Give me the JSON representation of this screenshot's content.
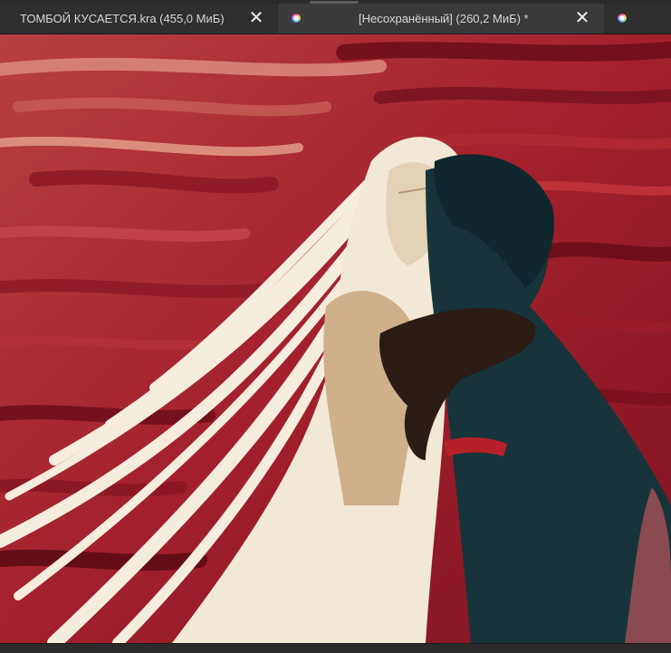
{
  "tabs": [
    {
      "label": "ТОМБОЙ КУСАЕТСЯ.kra (455,0 МиБ)",
      "close_glyph": "✕",
      "active": false
    },
    {
      "icon": "krita-app-icon",
      "label": "[Несохранённый]  (260,2 МиБ) *",
      "close_glyph": "✕",
      "active": true
    },
    {
      "icon": "krita-app-icon",
      "active": false
    }
  ],
  "canvas": {
    "artwork": "painting-canvas",
    "colors": {
      "background_red": "#a3202c",
      "hair_cream": "#f4ecdd",
      "skin_tan": "#cfb08a",
      "dark_teal": "#16343a",
      "dark_brown": "#2b1d16"
    }
  }
}
